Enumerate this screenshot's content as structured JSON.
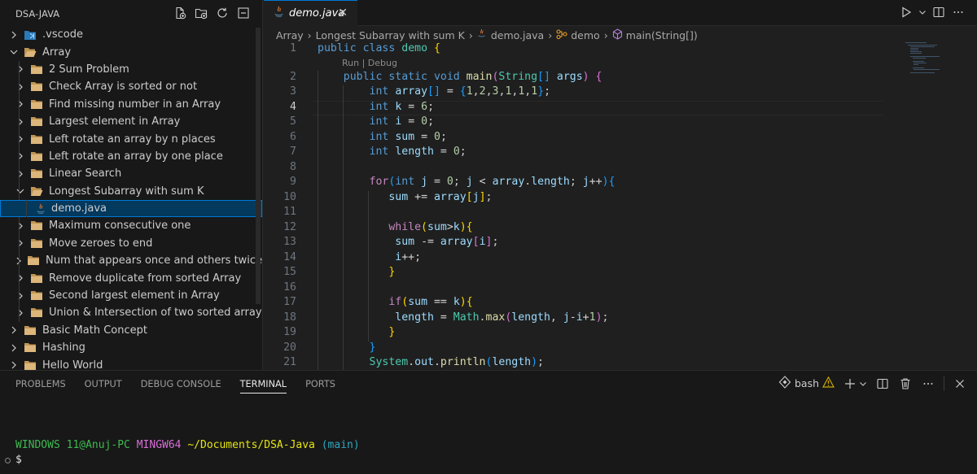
{
  "explorer": {
    "title": "DSA-JAVA",
    "actions": [
      "new-file-icon",
      "new-folder-icon",
      "refresh-icon",
      "collapse-icon"
    ],
    "items": [
      {
        "label": ".vscode",
        "depth": 0,
        "expanded": false,
        "kind": "vscode-folder"
      },
      {
        "label": "Array",
        "depth": 0,
        "expanded": true,
        "kind": "folder"
      },
      {
        "label": "2 Sum Problem",
        "depth": 1,
        "expanded": false,
        "kind": "folder"
      },
      {
        "label": "Check Array is sorted or not",
        "depth": 1,
        "expanded": false,
        "kind": "folder"
      },
      {
        "label": "Find missing number in an Array",
        "depth": 1,
        "expanded": false,
        "kind": "folder"
      },
      {
        "label": "Largest element in Array",
        "depth": 1,
        "expanded": false,
        "kind": "folder"
      },
      {
        "label": "Left rotate an array by n places",
        "depth": 1,
        "expanded": false,
        "kind": "folder"
      },
      {
        "label": "Left rotate an array by one place",
        "depth": 1,
        "expanded": false,
        "kind": "folder"
      },
      {
        "label": "Linear Search",
        "depth": 1,
        "expanded": false,
        "kind": "folder"
      },
      {
        "label": "Longest Subarray with sum K",
        "depth": 1,
        "expanded": true,
        "kind": "folder"
      },
      {
        "label": "demo.java",
        "depth": 2,
        "expanded": false,
        "kind": "java-file",
        "selected": true
      },
      {
        "label": "Maximum consecutive one",
        "depth": 1,
        "expanded": false,
        "kind": "folder"
      },
      {
        "label": "Move zeroes to end",
        "depth": 1,
        "expanded": false,
        "kind": "folder"
      },
      {
        "label": "Num that appears once and others twice",
        "depth": 1,
        "expanded": false,
        "kind": "folder"
      },
      {
        "label": "Remove duplicate from sorted Array",
        "depth": 1,
        "expanded": false,
        "kind": "folder"
      },
      {
        "label": "Second largest element in Array",
        "depth": 1,
        "expanded": false,
        "kind": "folder"
      },
      {
        "label": "Union & Intersection of two sorted array",
        "depth": 1,
        "expanded": false,
        "kind": "folder"
      },
      {
        "label": "Basic Math Concept",
        "depth": 0,
        "expanded": false,
        "kind": "folder"
      },
      {
        "label": "Hashing",
        "depth": 0,
        "expanded": false,
        "kind": "folder"
      },
      {
        "label": "Hello World",
        "depth": 0,
        "expanded": false,
        "kind": "folder"
      }
    ]
  },
  "editor": {
    "tab": {
      "label": "demo.java",
      "close": "✕"
    },
    "breadcrumbs": {
      "parts": [
        "Array",
        "Longest Subarray with sum K",
        "demo.java",
        "demo",
        "main(String[])"
      ]
    },
    "codelens": "Run | Debug",
    "active_line": 4,
    "line_numbers": [
      "1",
      "2",
      "3",
      "4",
      "5",
      "6",
      "7",
      "8",
      "9",
      "10",
      "11",
      "12",
      "13",
      "14",
      "15",
      "16",
      "17",
      "18",
      "19",
      "20",
      "21"
    ]
  },
  "panel": {
    "tabs": [
      "PROBLEMS",
      "OUTPUT",
      "DEBUG CONSOLE",
      "TERMINAL",
      "PORTS"
    ],
    "active_tab": "TERMINAL",
    "shell": "bash",
    "prompt": {
      "user_host": "WINDOWS 11@Anuj-PC",
      "env": "MINGW64",
      "path": "~/Documents/DSA-Java",
      "branch": "(main)",
      "symbol": "$"
    }
  },
  "colors": {
    "accent": "#0078d4",
    "selection": "#04395e",
    "folder": "#c09553",
    "java": "#e37933"
  }
}
